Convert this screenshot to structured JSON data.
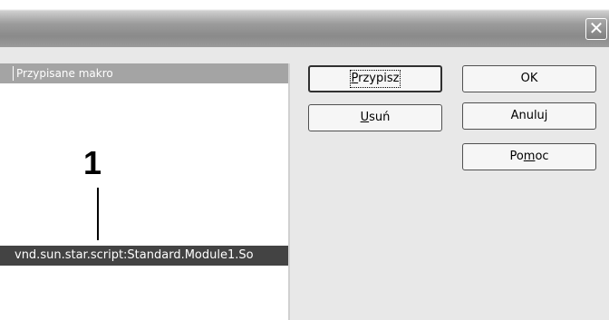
{
  "window": {
    "close_glyph": "✕"
  },
  "list": {
    "header": "Przypisane makro",
    "callout_number": "1",
    "selected_item": "vnd.sun.star.script:Standard.Module1.So"
  },
  "buttons": {
    "assign": {
      "before": "",
      "mnemonic": "P",
      "after": "rzypisz"
    },
    "remove": {
      "before": "",
      "mnemonic": "U",
      "after": "suń"
    },
    "ok": "OK",
    "cancel": "Anuluj",
    "help": {
      "before": "Po",
      "mnemonic": "m",
      "after": "oc"
    }
  }
}
